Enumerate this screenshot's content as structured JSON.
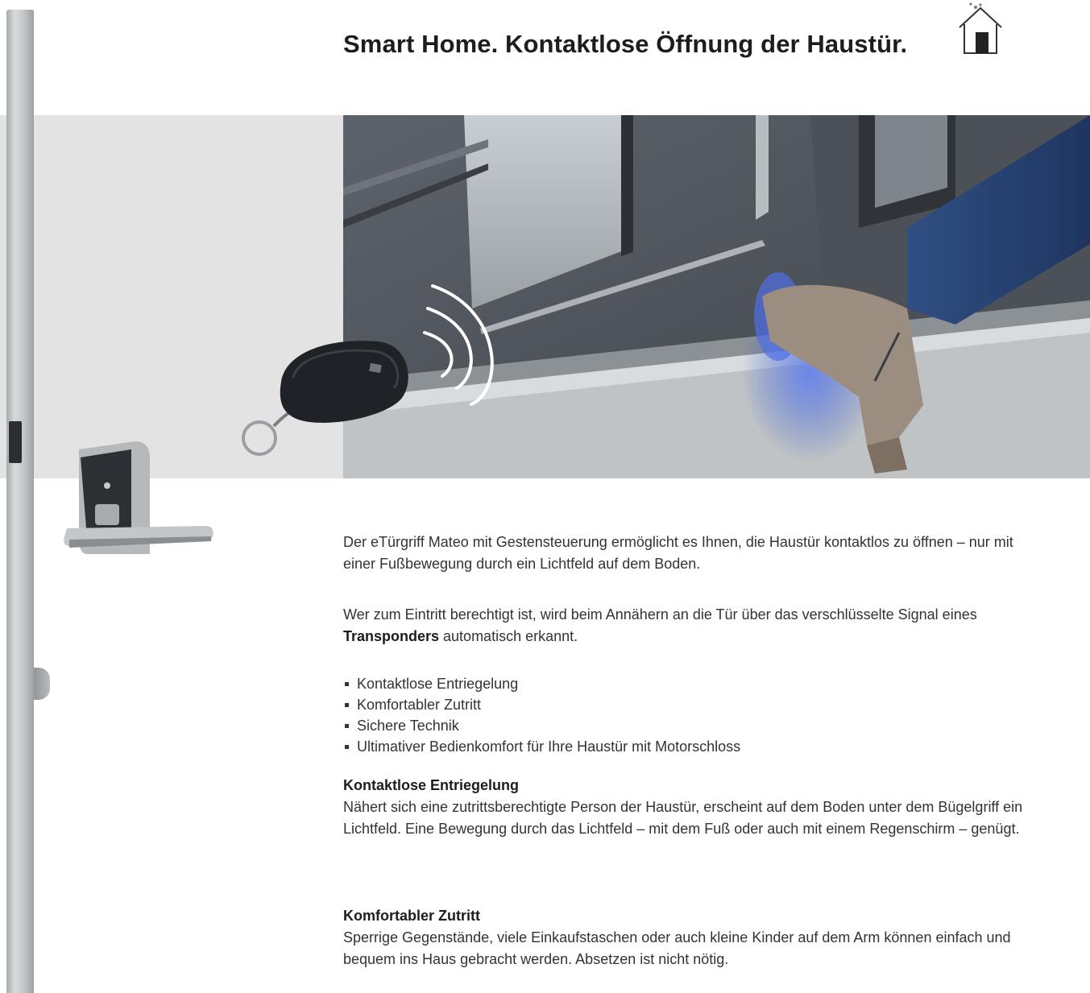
{
  "title": "Smart Home. Kontaktlose Öffnung der Haustür.",
  "icons": {
    "home": "home-wifi-icon"
  },
  "intro": "Der eTürgriff Mateo mit Gestensteuerung ermöglicht es Ihnen, die Haustür kontaktlos zu öffnen – nur mit einer Fußbewegung durch ein Lichtfeld auf dem Boden.",
  "p2": {
    "before": "Wer zum Eintritt berechtigt ist, wird beim Annähern an die Tür über das verschlüsselte Signal eines ",
    "bold": "Transponders",
    "after": " automatisch erkannt."
  },
  "features": [
    "Kontaktlose Entriegelung",
    "Komfortabler Zutritt",
    "Sichere Technik",
    "Ultimativer Bedienkomfort für Ihre Haustür mit Motorschloss"
  ],
  "sections": [
    {
      "heading": "Kontaktlose Entriegelung",
      "body": "Nähert sich eine zutrittsberechtigte Person der Haustür, erscheint auf dem Boden unter dem Bügelgriff ein Lichtfeld. Eine Bewegung durch das Lichtfeld – mit dem Fuß oder auch mit einem Regenschirm – genügt."
    },
    {
      "heading": "Komfortabler Zutritt",
      "body": "Sperrige Gegenstände, viele Einkaufstaschen oder auch kleine Kinder auf dem Arm können einfach und bequem ins Haus gebracht werden. Absetzen ist nicht nötig."
    }
  ],
  "colors": {
    "text": "#333333",
    "heading": "#1d1d1d",
    "panel": "#e3e3e3",
    "light_field": "#4a6fe0"
  }
}
